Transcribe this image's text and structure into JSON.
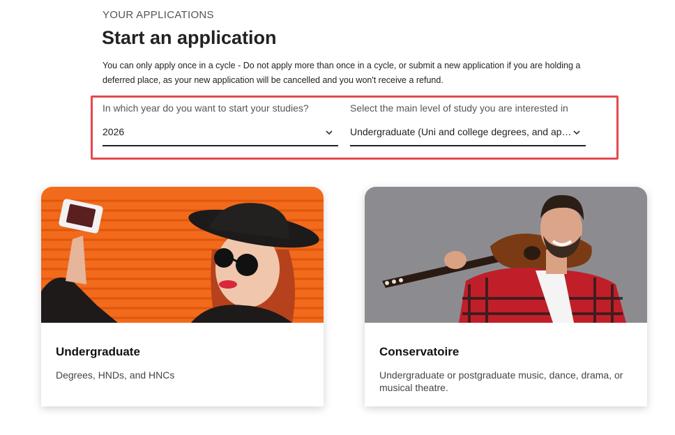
{
  "header": {
    "eyebrow": "YOUR APPLICATIONS",
    "title": "Start an application",
    "notice": "You can only apply once in a cycle - Do not apply more than once in a cycle, or submit a new application if you are holding a deferred place, as your new application will be cancelled and you won't receive a refund."
  },
  "selectors": {
    "highlight_color": "#e5484d",
    "year": {
      "label": "In which year do you want to start your studies?",
      "value": "2026",
      "icon": "chevron-down-icon"
    },
    "level": {
      "label": "Select the main level of study you are interested in",
      "value": "Undergraduate (Uni and college degrees, and apprenticeships)",
      "icon": "chevron-down-icon"
    }
  },
  "cards": [
    {
      "title": "Undergraduate",
      "description": "Degrees, HNDs, and HNCs",
      "image": "woman-taking-selfie-photo",
      "image_bg": "#f26a1b"
    },
    {
      "title": "Conservatoire",
      "description": "Undergraduate or postgraduate music, dance, drama, or musical theatre.",
      "image": "man-with-guitar-photo",
      "image_bg": "#8c8c90"
    }
  ]
}
